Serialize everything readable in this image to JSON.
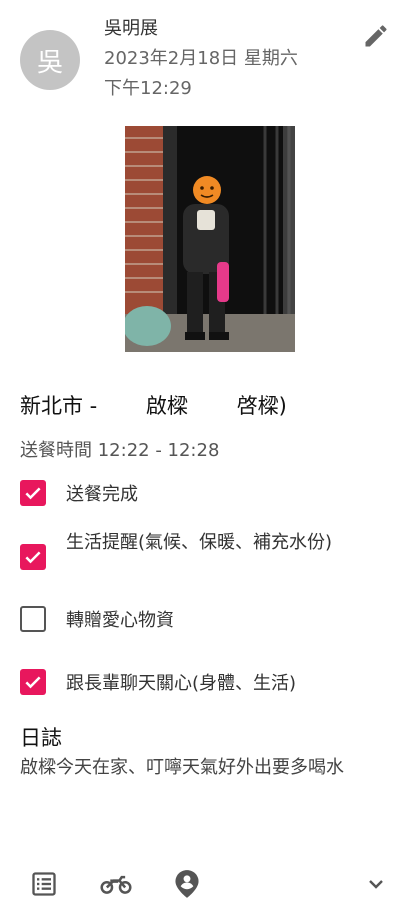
{
  "record": {
    "avatar_initial": "吳",
    "author_name": "吳明展",
    "date": "2023年2月18日 星期六",
    "time": "下午12:29"
  },
  "location": "新北市 -　　 啟樑　　 啓樑)",
  "delivery_time": "送餐時間 12:22 - 12:28",
  "tasks": [
    {
      "label": "送餐完成",
      "checked": true
    },
    {
      "label": "生活提醒(氣候、保暖、補充水份)",
      "checked": true
    },
    {
      "label": "轉贈愛心物資",
      "checked": false
    },
    {
      "label": "跟長輩聊天關心(身體、生活)",
      "checked": true
    }
  ],
  "log": {
    "title": "日誌",
    "text": "啟樑今天在家、叮嚀天氣好外出要多喝水"
  },
  "colors": {
    "accent": "#e8175d",
    "avatar_bg": "#c4c4c4",
    "icon": "#555555"
  },
  "bottom_bar": {
    "icons": [
      "list-icon",
      "motorcycle-icon",
      "location-pin-icon",
      "chevron-down-icon"
    ]
  }
}
